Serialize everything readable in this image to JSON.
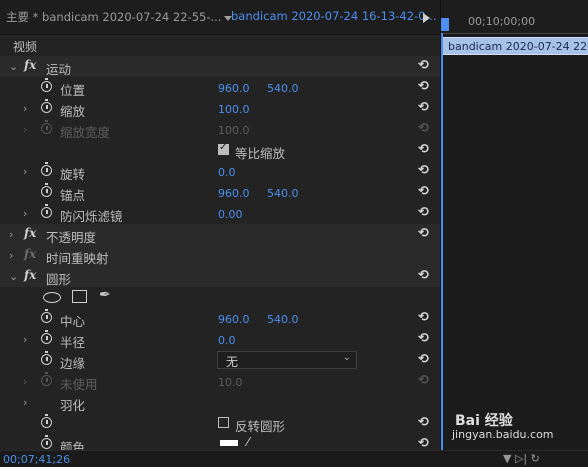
{
  "header": {
    "main_tab": "主要 * bandicam 2020-07-24 22-55-...",
    "clip_tab": "bandicam 2020-07-24 16-13-42-0..."
  },
  "section": {
    "video_label": "视频"
  },
  "effects": {
    "motion": {
      "label": "运动",
      "position": {
        "label": "位置",
        "x": "960.0",
        "y": "540.0"
      },
      "scale": {
        "label": "缩放",
        "value": "100.0"
      },
      "scale_width": {
        "label": "缩放宽度",
        "value": "100.0"
      },
      "uniform_scale": {
        "label": "等比缩放",
        "checked": true
      },
      "rotation": {
        "label": "旋转",
        "value": "0.0"
      },
      "anchor": {
        "label": "锚点",
        "x": "960.0",
        "y": "540.0"
      },
      "anti_flicker": {
        "label": "防闪烁滤镜",
        "value": "0.00"
      }
    },
    "opacity": {
      "label": "不透明度"
    },
    "time_remap": {
      "label": "时间重映射"
    },
    "circle": {
      "label": "圆形",
      "center": {
        "label": "中心",
        "x": "960.0",
        "y": "540.0"
      },
      "radius": {
        "label": "半径",
        "value": "0.0"
      },
      "edge": {
        "label": "边缘",
        "selected": "无"
      },
      "unused": {
        "label": "未使用",
        "value": "10.0"
      },
      "feather": {
        "label": "羽化"
      },
      "invert": {
        "label": "反转圆形",
        "checked": false
      },
      "color": {
        "label": "颜色",
        "value": "#ffffff"
      }
    }
  },
  "timeline": {
    "ruler_time": "00;10;00;00",
    "clip_label": "bandicam 2020-07-24 22-"
  },
  "footer": {
    "timecode": "00;07;41;26"
  },
  "watermark": {
    "brand": "Bai 经验",
    "url": "jingyan.baidu.com"
  },
  "colors": {
    "accent": "#4c8ff0",
    "panel_bg": "#232323",
    "clip": "#a8c1e6"
  },
  "icons": [
    "play-icon",
    "stopwatch-icon",
    "reset-icon",
    "fx-icon",
    "ellipse-mask-icon",
    "rectangle-mask-icon",
    "pen-mask-icon",
    "eyedropper-icon",
    "filter-icon"
  ]
}
